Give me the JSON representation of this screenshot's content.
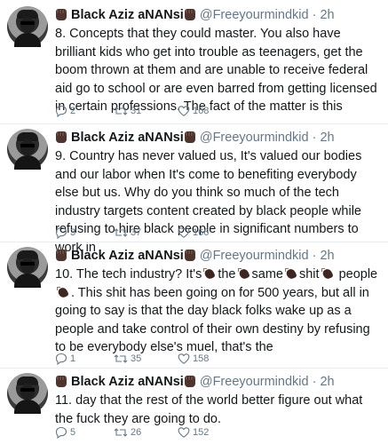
{
  "author": {
    "name": "Black Aziz aNANsi",
    "handle": "@Freeyourmindkid",
    "time": "2h"
  },
  "tweets": [
    {
      "text": "8. Concepts that they could master. You also have brilliant kids who get into trouble as teenagers, get the boom thrown at them and are unable to receive federal aid go to school or are even barred from getting licensed in certain professions. The fact of the matter is this",
      "replies": "2",
      "retweets": "31",
      "likes": "168"
    },
    {
      "text": "9. Country has never valued us, It's valued our bodies and our labor when It's come to benefiting everybody else but us. Why do you think so much of the tech industry targets content created by black people while refusing to hire black people in significant numbers to work in",
      "replies": "3",
      "retweets": "37",
      "likes": "166"
    },
    {
      "parts": [
        "10. The tech industry? It's",
        "the",
        "same",
        "shit",
        "people",
        ". This shit has been going on for 500 years, but all in going to say is that the day black folks wake up as a people and take control of their own destiny by refusing to be everybody else's muel, that's the"
      ],
      "replies": "1",
      "retweets": "35",
      "likes": "158"
    },
    {
      "text": "11. day that the rest of the world better figure out what the fuck they are going to do.",
      "replies": "5",
      "retweets": "26",
      "likes": "152"
    }
  ],
  "icons": {
    "name_emoji": "raised-fist-dark-icon",
    "inline_emoji": "clapping-hands-dark-icon",
    "reply": "reply-icon",
    "retweet": "retweet-icon",
    "like": "heart-icon"
  },
  "colors": {
    "text": "#14171a",
    "secondary": "#657786",
    "divider": "#e6ecf0",
    "emoji": "#3e2723"
  }
}
